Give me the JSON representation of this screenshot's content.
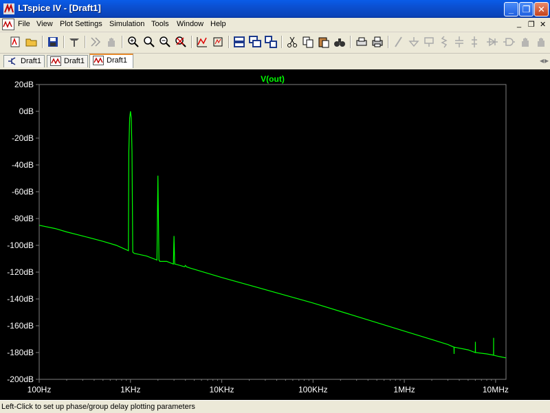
{
  "window": {
    "title": "LTspice IV - [Draft1]"
  },
  "menu": {
    "items": [
      "File",
      "View",
      "Plot Settings",
      "Simulation",
      "Tools",
      "Window",
      "Help"
    ],
    "mdi_controls": [
      "_",
      "❐",
      "✕"
    ]
  },
  "toolbar": {
    "icons": [
      "new-schematic-icon",
      "open-icon",
      "save-icon",
      "control-panel-icon",
      "run-icon",
      "pan-hand-icon",
      "zoom-in-icon",
      "zoom-box-icon",
      "zoom-out-icon",
      "zoom-cancel-icon",
      "autorange-icon",
      "fit-icon",
      "tile-horizontal-icon",
      "cascade-icon",
      "tile-vertical-icon",
      "cut-icon",
      "copy-icon",
      "paste-icon",
      "find-icon",
      "print-preview-icon",
      "print-icon",
      "wire-icon",
      "ground-icon",
      "label-icon",
      "resistor-icon",
      "capacitor-icon",
      "inductor-icon",
      "diode-icon",
      "component-icon",
      "move-icon"
    ]
  },
  "tabs": [
    {
      "label": "Draft1",
      "icon": "schematic-icon",
      "active": false
    },
    {
      "label": "Draft1",
      "icon": "waveform-icon",
      "active": false
    },
    {
      "label": "Draft1",
      "icon": "waveform-icon",
      "active": true
    }
  ],
  "chart_data": {
    "type": "line",
    "title": "V(out)",
    "xlabel": "",
    "ylabel": "",
    "x_scale": "log",
    "xlim": [
      100,
      13000000
    ],
    "ylim": [
      -200,
      20
    ],
    "x_ticks": [
      100,
      1000,
      10000,
      100000,
      1000000,
      10000000
    ],
    "x_tick_labels": [
      "100Hz",
      "1KHz",
      "10KHz",
      "100KHz",
      "1MHz",
      "10MHz"
    ],
    "y_ticks": [
      20,
      0,
      -20,
      -40,
      -60,
      -80,
      -100,
      -120,
      -140,
      -160,
      -180,
      -200
    ],
    "y_tick_labels": [
      "20dB",
      "0dB",
      "-20dB",
      "-40dB",
      "-60dB",
      "-80dB",
      "-100dB",
      "-120dB",
      "-140dB",
      "-160dB",
      "-180dB",
      "-200dB"
    ],
    "grid": false,
    "colors": {
      "background": "#000000",
      "trace": "#00ff00",
      "axis": "#808080",
      "text": "#ffffff"
    },
    "series": [
      {
        "name": "V(out)",
        "x": [
          100,
          150,
          200,
          300,
          500,
          700,
          950,
          960,
          980,
          1000,
          1020,
          1040,
          1060,
          1100,
          1500,
          1950,
          2000,
          2050,
          2100,
          2500,
          2950,
          3000,
          3050,
          3100,
          3500,
          3900,
          4000,
          4100,
          4500,
          10000,
          100000,
          1000000,
          3000000,
          3500000,
          3510000,
          3520000,
          5000000,
          6000000,
          6010000,
          6020000,
          8000000,
          9500000,
          9510000,
          9520000,
          11000000,
          13000000
        ],
        "y": [
          -85,
          -87.5,
          -90,
          -93,
          -97,
          -100,
          -104,
          -30,
          -5,
          0,
          -5,
          -30,
          -105,
          -106,
          -108,
          -111,
          -48,
          -111,
          -112,
          -112,
          -114,
          -93,
          -114,
          -114,
          -115,
          -116,
          -115,
          -116,
          -117,
          -124,
          -143,
          -164,
          -174,
          -176,
          -181,
          -176,
          -178,
          -180,
          -172,
          -180,
          -181,
          -182,
          -169,
          -182,
          -183,
          -184
        ]
      }
    ]
  },
  "status": {
    "text": "Left-Click to set up phase/group delay plotting parameters"
  }
}
